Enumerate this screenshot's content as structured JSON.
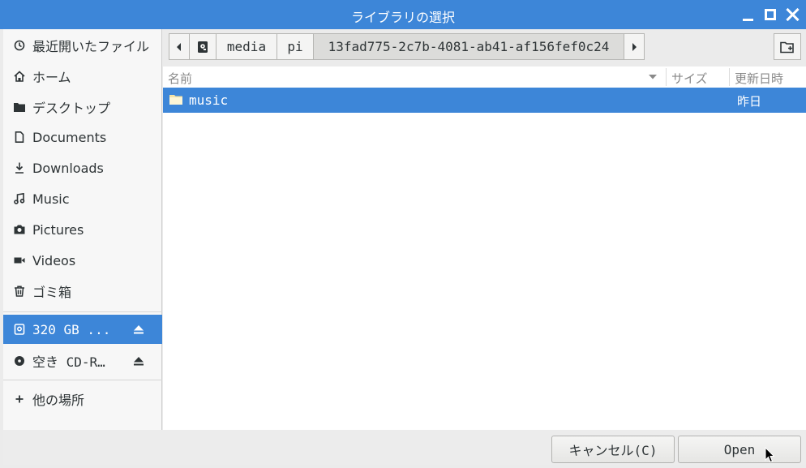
{
  "window": {
    "title": "ライブラリの選択"
  },
  "sidebar": {
    "items": [
      {
        "label": "最近開いたファイル",
        "icon": "clock-icon"
      },
      {
        "label": "ホーム",
        "icon": "home-icon"
      },
      {
        "label": "デスクトップ",
        "icon": "folder-icon"
      },
      {
        "label": "Documents",
        "icon": "document-icon"
      },
      {
        "label": "Downloads",
        "icon": "download-icon"
      },
      {
        "label": "Music",
        "icon": "music-icon"
      },
      {
        "label": "Pictures",
        "icon": "camera-icon"
      },
      {
        "label": "Videos",
        "icon": "video-icon"
      },
      {
        "label": "ゴミ箱",
        "icon": "trash-icon"
      }
    ],
    "devices": [
      {
        "label": "320 GB ...",
        "icon": "drive-icon",
        "selected": true
      },
      {
        "label": "空き CD-R…",
        "icon": "disc-icon",
        "selected": false
      }
    ],
    "other": {
      "label": "他の場所",
      "icon": "plus-icon"
    }
  },
  "pathbar": {
    "segments": [
      "media",
      "pi",
      "13fad775-2c7b-4081-ab41-af156fef0c24"
    ]
  },
  "filelist": {
    "columns": {
      "name": "名前",
      "size": "サイズ",
      "modified": "更新日時"
    },
    "rows": [
      {
        "name": "music",
        "size": "",
        "modified": "昨日",
        "selected": true
      }
    ]
  },
  "actions": {
    "cancel_label": "キャンセル(C)",
    "open_label": "Open"
  },
  "colors": {
    "accent": "#3d86d8",
    "selection_text": "#ffffff"
  }
}
